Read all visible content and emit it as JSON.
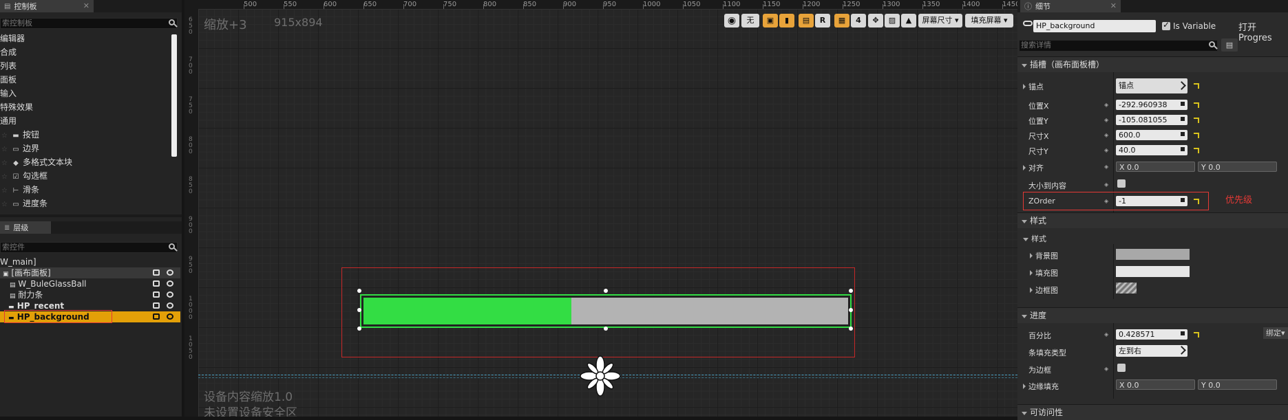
{
  "palette": {
    "tab_title": "控制板",
    "search_placeholder": "索控制板",
    "categories": [
      "编辑器",
      "合成",
      "列表",
      "面板",
      "输入",
      "特殊效果",
      "通用"
    ],
    "items": [
      {
        "label": "按钮",
        "icon": "button-icon"
      },
      {
        "label": "边界",
        "icon": "border-icon"
      },
      {
        "label": "多格式文本块",
        "icon": "richtext-icon"
      },
      {
        "label": "勾选框",
        "icon": "checkbox-icon"
      },
      {
        "label": "滑条",
        "icon": "slider-icon"
      },
      {
        "label": "进度条",
        "icon": "progressbar-icon"
      }
    ]
  },
  "hierarchy": {
    "tab_title": "层级",
    "search_placeholder": "索控件",
    "rows": [
      {
        "label": "W_main]",
        "selected": false
      },
      {
        "label": "[画布面板]",
        "selected": false
      },
      {
        "label": "W_BuleGlassBall",
        "selected": false
      },
      {
        "label": "耐力条",
        "selected": false
      },
      {
        "label": "HP_recent",
        "selected": false
      },
      {
        "label": "HP_background",
        "selected": true
      }
    ]
  },
  "viewport": {
    "ruler_labels": [
      "500",
      "550",
      "600",
      "650",
      "700",
      "750",
      "800",
      "850",
      "900",
      "950",
      "1000",
      "1050",
      "1100",
      "1150",
      "1200",
      "1250",
      "1300",
      "1350",
      "1400",
      "1450"
    ],
    "ruler_left_groups": [
      "650",
      "700",
      "750",
      "800",
      "850",
      "900",
      "950",
      "1000",
      "1050"
    ],
    "zoom_text": "缩放+3",
    "resolution": "915x894",
    "none_label": "无",
    "r_label": "R",
    "grid_snap": "4",
    "screen_size_label": "屏幕尺寸",
    "fill_screen_label": "填充屏幕",
    "dpi_text": "设备内容缩放1.0",
    "safe_zone_text": "未设置设备安全区",
    "progress_percent": 0.428571,
    "fill_color": "#33dd44",
    "background_color": "#b3b3b3"
  },
  "details": {
    "tab_title": "细节",
    "widget_name": "HP_background",
    "is_variable_label": "Is Variable",
    "open_label": "打开Progres",
    "search_placeholder": "搜索详情",
    "slot_section": "插槽（画布面板槽）",
    "anchor_label": "锚点",
    "anchor_value": "锚点",
    "pos_x_label": "位置X",
    "pos_x_value": "-292.960938",
    "pos_y_label": "位置Y",
    "pos_y_value": "-105.081055",
    "size_x_label": "尺寸X",
    "size_x_value": "600.0",
    "size_y_label": "尺寸Y",
    "size_y_value": "40.0",
    "align_label": "对齐",
    "align_x": "X  0.0",
    "align_y": "Y  0.0",
    "size_to_content_label": "大小到内容",
    "zorder_label": "ZOrder",
    "zorder_value": "-1",
    "priority_note": "优先级",
    "style_section": "样式",
    "style_sub": "样式",
    "bg_image_label": "背景图",
    "fill_image_label": "填充图",
    "border_image_label": "边框图",
    "progress_section": "进度",
    "percent_label": "百分比",
    "percent_value": "0.428571",
    "bind_label": "绑定",
    "fill_type_label": "条填充类型",
    "fill_type_value": "左到右",
    "marquee_label": "为边框",
    "border_pad_label": "边缘填充",
    "border_pad_x": "X  0.0",
    "border_pad_y": "Y  0.0",
    "access_section": "可访问性"
  }
}
